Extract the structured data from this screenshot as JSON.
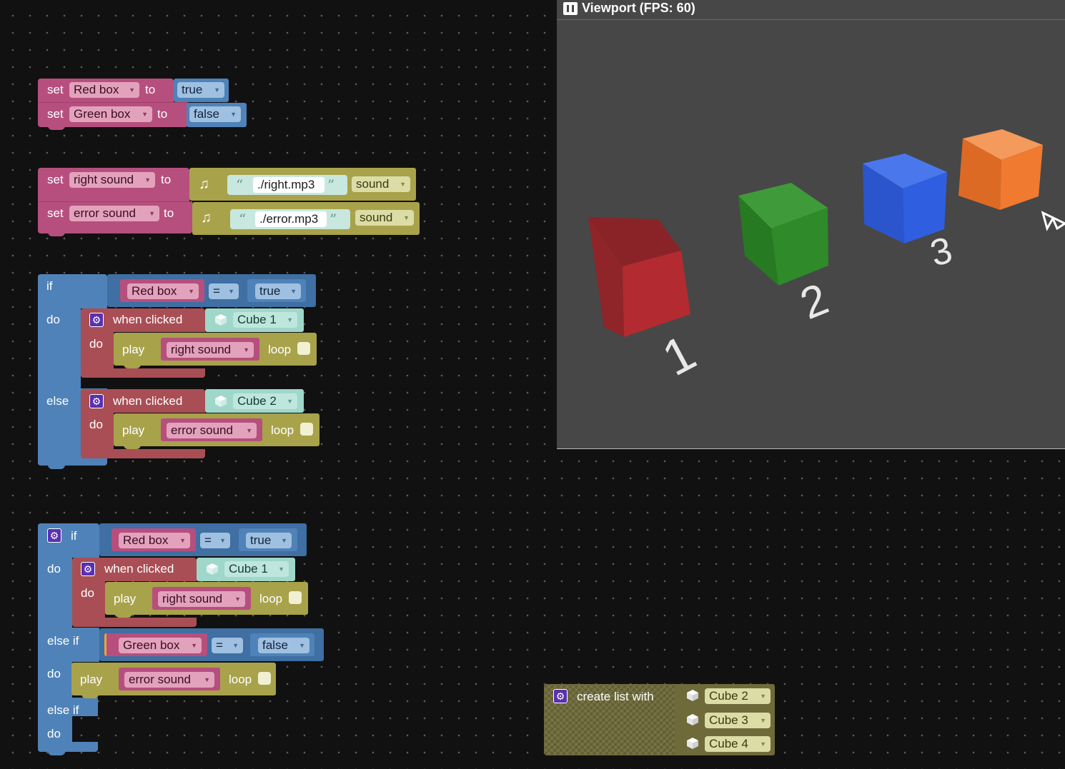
{
  "viewport": {
    "title": "Viewport (FPS: 60)",
    "labels": [
      "1",
      "2",
      "3"
    ],
    "cube_colors": [
      "#b32b30",
      "#2f8a2a",
      "#2f5fe0",
      "#f07a30"
    ]
  },
  "kw": {
    "set": "set",
    "to": "to",
    "if": "if",
    "do": "do",
    "else": "else",
    "else_if": "else if",
    "when_clicked": "when clicked",
    "play": "play",
    "loop": "loop",
    "sound": "sound",
    "eq": "=",
    "create_list": "create list with"
  },
  "vars": {
    "red_box": "Red box",
    "green_box": "Green box",
    "right_sound": "right sound",
    "error_sound": "error sound"
  },
  "values": {
    "true": "true",
    "false": "false"
  },
  "files": {
    "right": "./right.mp3",
    "error": "./error.mp3"
  },
  "cubes": {
    "c1": "Cube 1",
    "c2": "Cube 2",
    "c3": "Cube 3",
    "c4": "Cube 4"
  },
  "colors": {
    "variable_block": "#b64f7e",
    "logic_block": "#4f82b8",
    "event_block": "#a94e55",
    "sound_block": "#a8a24b",
    "object_block": "#9fd8cb"
  }
}
